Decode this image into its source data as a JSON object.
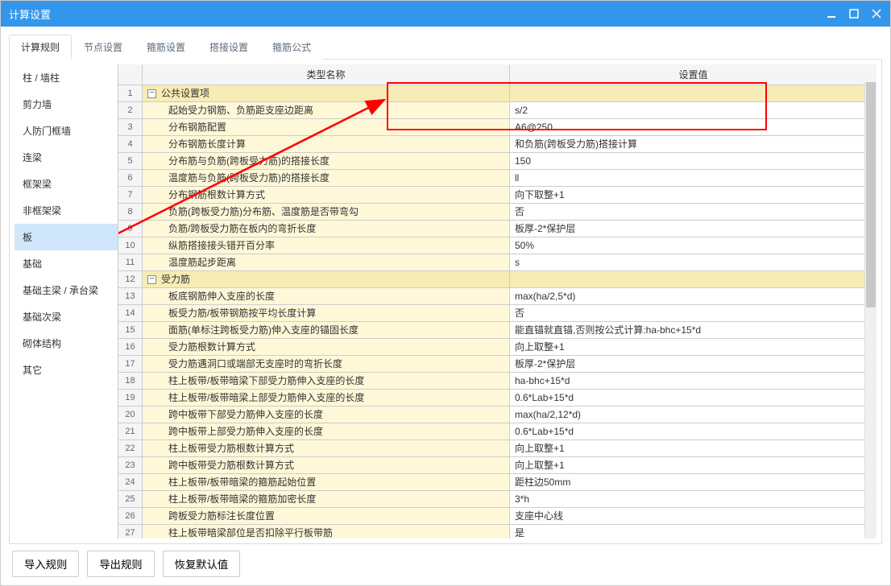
{
  "window": {
    "title": "计算设置"
  },
  "tabs": [
    "计算规则",
    "节点设置",
    "箍筋设置",
    "搭接设置",
    "箍筋公式"
  ],
  "activeTab": 0,
  "sidebar": {
    "items": [
      "柱 / 墙柱",
      "剪力墙",
      "人防门框墙",
      "连梁",
      "框架梁",
      "非框架梁",
      "板",
      "基础",
      "基础主梁 / 承台梁",
      "基础次梁",
      "砌体结构",
      "其它"
    ],
    "selected": 6
  },
  "table": {
    "headers": {
      "type": "类型名称",
      "value": "设置值"
    },
    "rows": [
      {
        "num": 1,
        "group": true,
        "type": "公共设置项",
        "value": ""
      },
      {
        "num": 2,
        "type": "起始受力钢筋、负筋距支座边距离",
        "value": "s/2"
      },
      {
        "num": 3,
        "type": "分布钢筋配置",
        "value": "A6@250"
      },
      {
        "num": 4,
        "type": "分布钢筋长度计算",
        "value": "和负筋(跨板受力筋)搭接计算"
      },
      {
        "num": 5,
        "type": "分布筋与负筋(跨板受力筋)的搭接长度",
        "value": "150"
      },
      {
        "num": 6,
        "type": "温度筋与负筋(跨板受力筋)的搭接长度",
        "value": "ll"
      },
      {
        "num": 7,
        "type": "分布钢筋根数计算方式",
        "value": "向下取整+1"
      },
      {
        "num": 8,
        "type": "负筋(跨板受力筋)分布筋、温度筋是否带弯勾",
        "value": "否"
      },
      {
        "num": 9,
        "type": "负筋/跨板受力筋在板内的弯折长度",
        "value": "板厚-2*保护层"
      },
      {
        "num": 10,
        "type": "纵筋搭接接头错开百分率",
        "value": "50%"
      },
      {
        "num": 11,
        "type": "温度筋起步距离",
        "value": "s"
      },
      {
        "num": 12,
        "group": true,
        "type": "受力筋",
        "value": ""
      },
      {
        "num": 13,
        "type": "板底钢筋伸入支座的长度",
        "value": "max(ha/2,5*d)"
      },
      {
        "num": 14,
        "type": "板受力筋/板带钢筋按平均长度计算",
        "value": "否"
      },
      {
        "num": 15,
        "type": "面筋(单标注跨板受力筋)伸入支座的锚固长度",
        "value": "能直锚就直锚,否则按公式计算:ha-bhc+15*d"
      },
      {
        "num": 16,
        "type": "受力筋根数计算方式",
        "value": "向上取整+1"
      },
      {
        "num": 17,
        "type": "受力筋遇洞口或端部无支座时的弯折长度",
        "value": "板厚-2*保护层"
      },
      {
        "num": 18,
        "type": "柱上板带/板带暗梁下部受力筋伸入支座的长度",
        "value": "ha-bhc+15*d"
      },
      {
        "num": 19,
        "type": "柱上板带/板带暗梁上部受力筋伸入支座的长度",
        "value": "0.6*Lab+15*d"
      },
      {
        "num": 20,
        "type": "跨中板带下部受力筋伸入支座的长度",
        "value": "max(ha/2,12*d)"
      },
      {
        "num": 21,
        "type": "跨中板带上部受力筋伸入支座的长度",
        "value": "0.6*Lab+15*d"
      },
      {
        "num": 22,
        "type": "柱上板带受力筋根数计算方式",
        "value": "向上取整+1"
      },
      {
        "num": 23,
        "type": "跨中板带受力筋根数计算方式",
        "value": "向上取整+1"
      },
      {
        "num": 24,
        "type": "柱上板带/板带暗梁的箍筋起始位置",
        "value": "距柱边50mm"
      },
      {
        "num": 25,
        "type": "柱上板带/板带暗梁的箍筋加密长度",
        "value": "3*h"
      },
      {
        "num": 26,
        "type": "跨板受力筋标注长度位置",
        "value": "支座中心线"
      },
      {
        "num": 27,
        "type": "柱上板带暗梁部位是否扣除平行板带筋",
        "value": "是"
      }
    ]
  },
  "footer": {
    "import": "导入规则",
    "export": "导出规则",
    "restore": "恢复默认值"
  }
}
